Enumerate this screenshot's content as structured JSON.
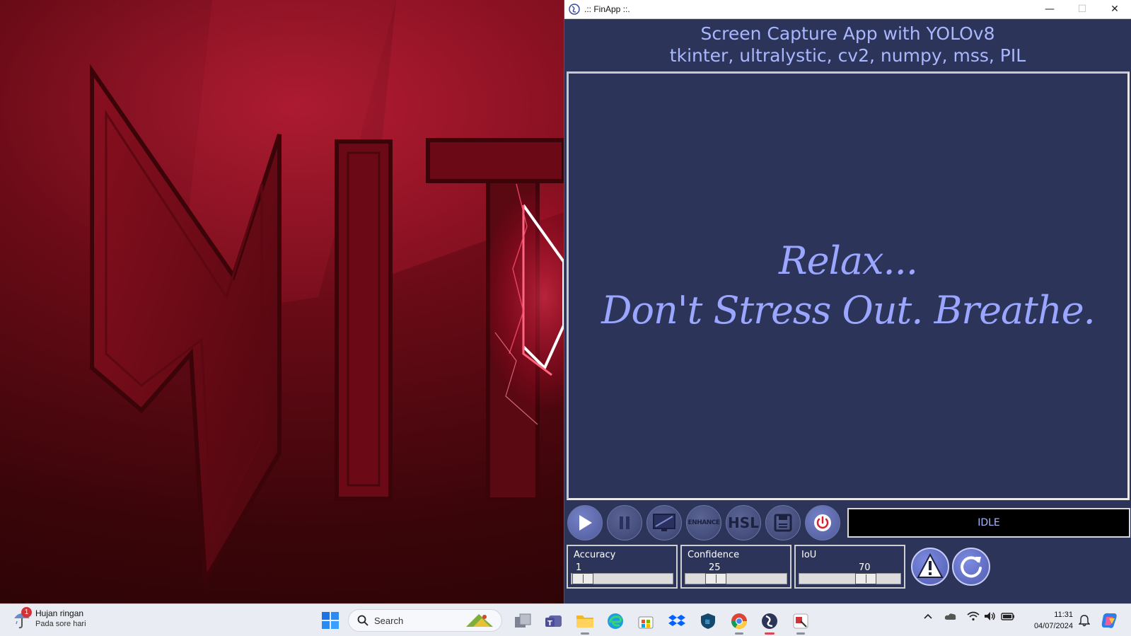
{
  "window": {
    "title": ".:: FinApp ::.",
    "minimize": "—",
    "maximize": "☐",
    "close": "✕"
  },
  "header": {
    "line1": "Screen Capture App with YOLOv8",
    "line2": "tkinter, ultralystic, cv2, numpy, mss, PIL"
  },
  "display": {
    "line1": "Relax...",
    "line2": "Don't Stress Out. Breathe."
  },
  "toolbar": {
    "enhance_label": "ENHANCE",
    "hsl_label": "HSL",
    "status": "IDLE"
  },
  "sliders": [
    {
      "label": "Accuracy",
      "value": "1",
      "fraction": 0.01
    },
    {
      "label": "Confidence",
      "value": "25",
      "fraction": 0.25
    },
    {
      "label": "IoU",
      "value": "70",
      "fraction": 0.7
    }
  ],
  "taskbar": {
    "weather_badge": "1",
    "weather_title": "Hujan ringan",
    "weather_sub": "Pada sore hari",
    "search_label": "Search",
    "time": "11:31",
    "date": "04/07/2024"
  },
  "colors": {
    "app_bg": "#2c3459",
    "accent_text": "#a9b7ff",
    "status_bg": "#000000"
  }
}
